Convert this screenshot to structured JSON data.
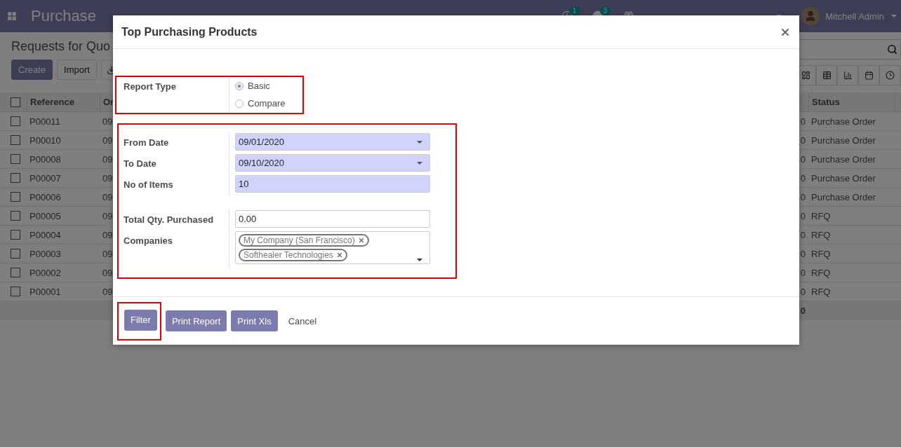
{
  "navbar": {
    "app_name": "Purchase",
    "activity_badge": "1",
    "messages_badge": "3",
    "user": "Mitchell Admin"
  },
  "control_panel": {
    "title": "Requests for Quo",
    "buttons": [
      {
        "label": "Create",
        "kind": "primary"
      },
      {
        "label": "Import",
        "kind": "secondary"
      }
    ]
  },
  "table": {
    "all_checked": false,
    "columns": [
      "Reference",
      "Or",
      "",
      "Status"
    ],
    "rows": [
      {
        "checked": false,
        "cells": [
          "P00011",
          "09",
          "0",
          "Purchase Order"
        ]
      },
      {
        "checked": false,
        "cells": [
          "P00010",
          "09",
          "0",
          "Purchase Order"
        ]
      },
      {
        "checked": false,
        "cells": [
          "P00008",
          "09",
          "0",
          "Purchase Order"
        ]
      },
      {
        "checked": false,
        "cells": [
          "P00007",
          "09",
          "0",
          "Purchase Order"
        ]
      },
      {
        "checked": false,
        "cells": [
          "P00006",
          "09",
          "0",
          "Purchase Order"
        ]
      },
      {
        "checked": false,
        "cells": [
          "P00005",
          "09",
          "0",
          "RFQ"
        ]
      },
      {
        "checked": false,
        "cells": [
          "P00004",
          "09",
          "0",
          "RFQ"
        ]
      },
      {
        "checked": false,
        "cells": [
          "P00003",
          "09",
          "0",
          "RFQ"
        ]
      },
      {
        "checked": false,
        "cells": [
          "P00002",
          "09",
          "0",
          "RFQ"
        ]
      },
      {
        "checked": false,
        "cells": [
          "P00001",
          "09",
          "0",
          "RFQ"
        ]
      }
    ],
    "total": "0"
  },
  "dialog": {
    "title": "Top Purchasing Products",
    "report_type": {
      "label": "Report Type",
      "highlighted": true,
      "options": [
        {
          "label": "Basic",
          "selected": true
        },
        {
          "label": "Compare",
          "selected": false
        }
      ]
    },
    "form": {
      "highlighted": true,
      "groups": [
        {
          "fields": [
            {
              "label": "From Date",
              "kind": "date",
              "required": true,
              "value": "09/01/2020"
            },
            {
              "label": "To Date",
              "kind": "date",
              "required": true,
              "value": "09/10/2020"
            },
            {
              "label": "No of Items",
              "kind": "text",
              "required": true,
              "value": "10"
            }
          ]
        },
        {
          "fields": [
            {
              "label": "Total Qty. Purchased",
              "kind": "text",
              "required": false,
              "value": "0.00"
            },
            {
              "label": "Companies",
              "kind": "tags",
              "required": false,
              "tags": [
                "My Company (San Francisco)",
                "Softhealer Technologies"
              ]
            }
          ]
        }
      ]
    },
    "buttons": [
      {
        "label": "Filter",
        "kind": "primary",
        "highlighted": true
      },
      {
        "label": "Print Report",
        "kind": "primary",
        "highlighted": false
      },
      {
        "label": "Print Xls",
        "kind": "primary",
        "highlighted": false
      },
      {
        "label": "Cancel",
        "kind": "link",
        "highlighted": false
      }
    ]
  }
}
